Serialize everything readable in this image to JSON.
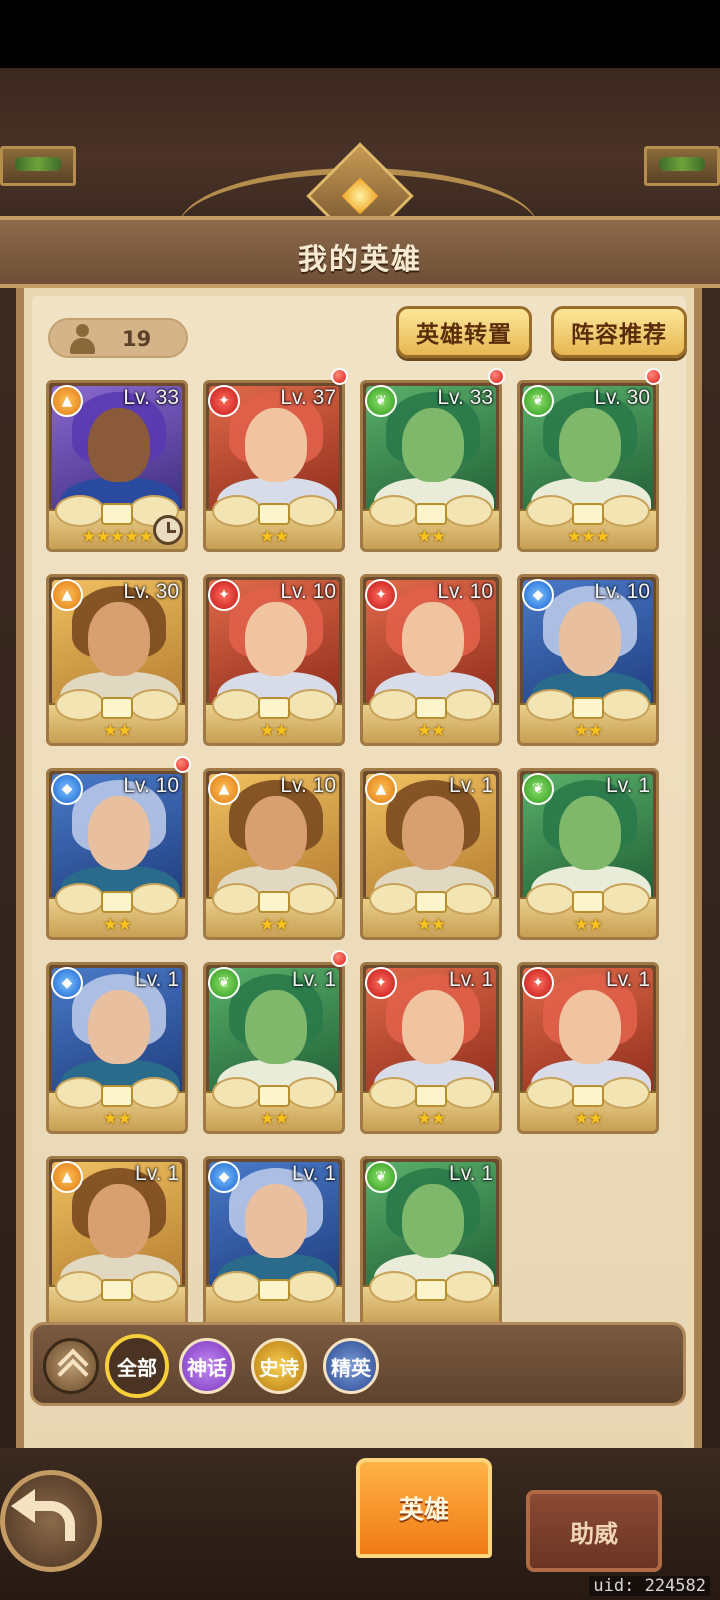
{
  "header": {
    "title": "我的英雄"
  },
  "hero_count": "19",
  "buttons": {
    "transfer": "英雄转置",
    "lineup": "阵容推荐"
  },
  "heroes": [
    {
      "level": "Lv. 33",
      "faction": "earth",
      "stars": "★★★★★",
      "bg": "purple",
      "red_dot": false,
      "clock": true
    },
    {
      "level": "Lv. 37",
      "faction": "fire",
      "stars": "★★",
      "bg": "red",
      "red_dot": true,
      "clock": false
    },
    {
      "level": "Lv. 33",
      "faction": "wood",
      "stars": "★★",
      "bg": "green",
      "red_dot": true,
      "clock": false
    },
    {
      "level": "Lv. 30",
      "faction": "wood",
      "stars": "★★★",
      "bg": "green",
      "red_dot": true,
      "clock": false
    },
    {
      "level": "Lv. 30",
      "faction": "earth",
      "stars": "★★",
      "bg": "gold",
      "red_dot": false,
      "clock": false
    },
    {
      "level": "Lv. 10",
      "faction": "fire",
      "stars": "★★",
      "bg": "red",
      "red_dot": false,
      "clock": false
    },
    {
      "level": "Lv. 10",
      "faction": "fire",
      "stars": "★★",
      "bg": "red",
      "red_dot": false,
      "clock": false
    },
    {
      "level": "Lv. 10",
      "faction": "water",
      "stars": "★★",
      "bg": "blue",
      "red_dot": false,
      "clock": false
    },
    {
      "level": "Lv. 10",
      "faction": "water",
      "stars": "★★",
      "bg": "blue",
      "red_dot": true,
      "clock": false
    },
    {
      "level": "Lv. 10",
      "faction": "earth",
      "stars": "★★",
      "bg": "gold",
      "red_dot": false,
      "clock": false
    },
    {
      "level": "Lv. 1",
      "faction": "earth",
      "stars": "★★",
      "bg": "gold",
      "red_dot": false,
      "clock": false
    },
    {
      "level": "Lv. 1",
      "faction": "wood",
      "stars": "★★",
      "bg": "green",
      "red_dot": false,
      "clock": false
    },
    {
      "level": "Lv. 1",
      "faction": "water",
      "stars": "★★",
      "bg": "blue",
      "red_dot": false,
      "clock": false
    },
    {
      "level": "Lv. 1",
      "faction": "wood",
      "stars": "★★",
      "bg": "green",
      "red_dot": true,
      "clock": false
    },
    {
      "level": "Lv. 1",
      "faction": "fire",
      "stars": "★★",
      "bg": "red",
      "red_dot": false,
      "clock": false
    },
    {
      "level": "Lv. 1",
      "faction": "fire",
      "stars": "★★",
      "bg": "red",
      "red_dot": false,
      "clock": false
    },
    {
      "level": "Lv. 1",
      "faction": "earth",
      "stars": "",
      "bg": "gold",
      "red_dot": false,
      "clock": false
    },
    {
      "level": "Lv. 1",
      "faction": "water",
      "stars": "",
      "bg": "blue",
      "red_dot": false,
      "clock": false
    },
    {
      "level": "Lv. 1",
      "faction": "wood",
      "stars": "",
      "bg": "green",
      "red_dot": false,
      "clock": false
    }
  ],
  "filters": {
    "all": "全部",
    "myth": "神话",
    "epic": "史诗",
    "elite": "精英"
  },
  "tabs": {
    "hero": "英雄",
    "cheer": "助威"
  },
  "uid": "uid: 224582",
  "colors": {
    "accent": "#f07a14",
    "gold": "#f7cf3a",
    "parchment": "#ead8b4"
  }
}
